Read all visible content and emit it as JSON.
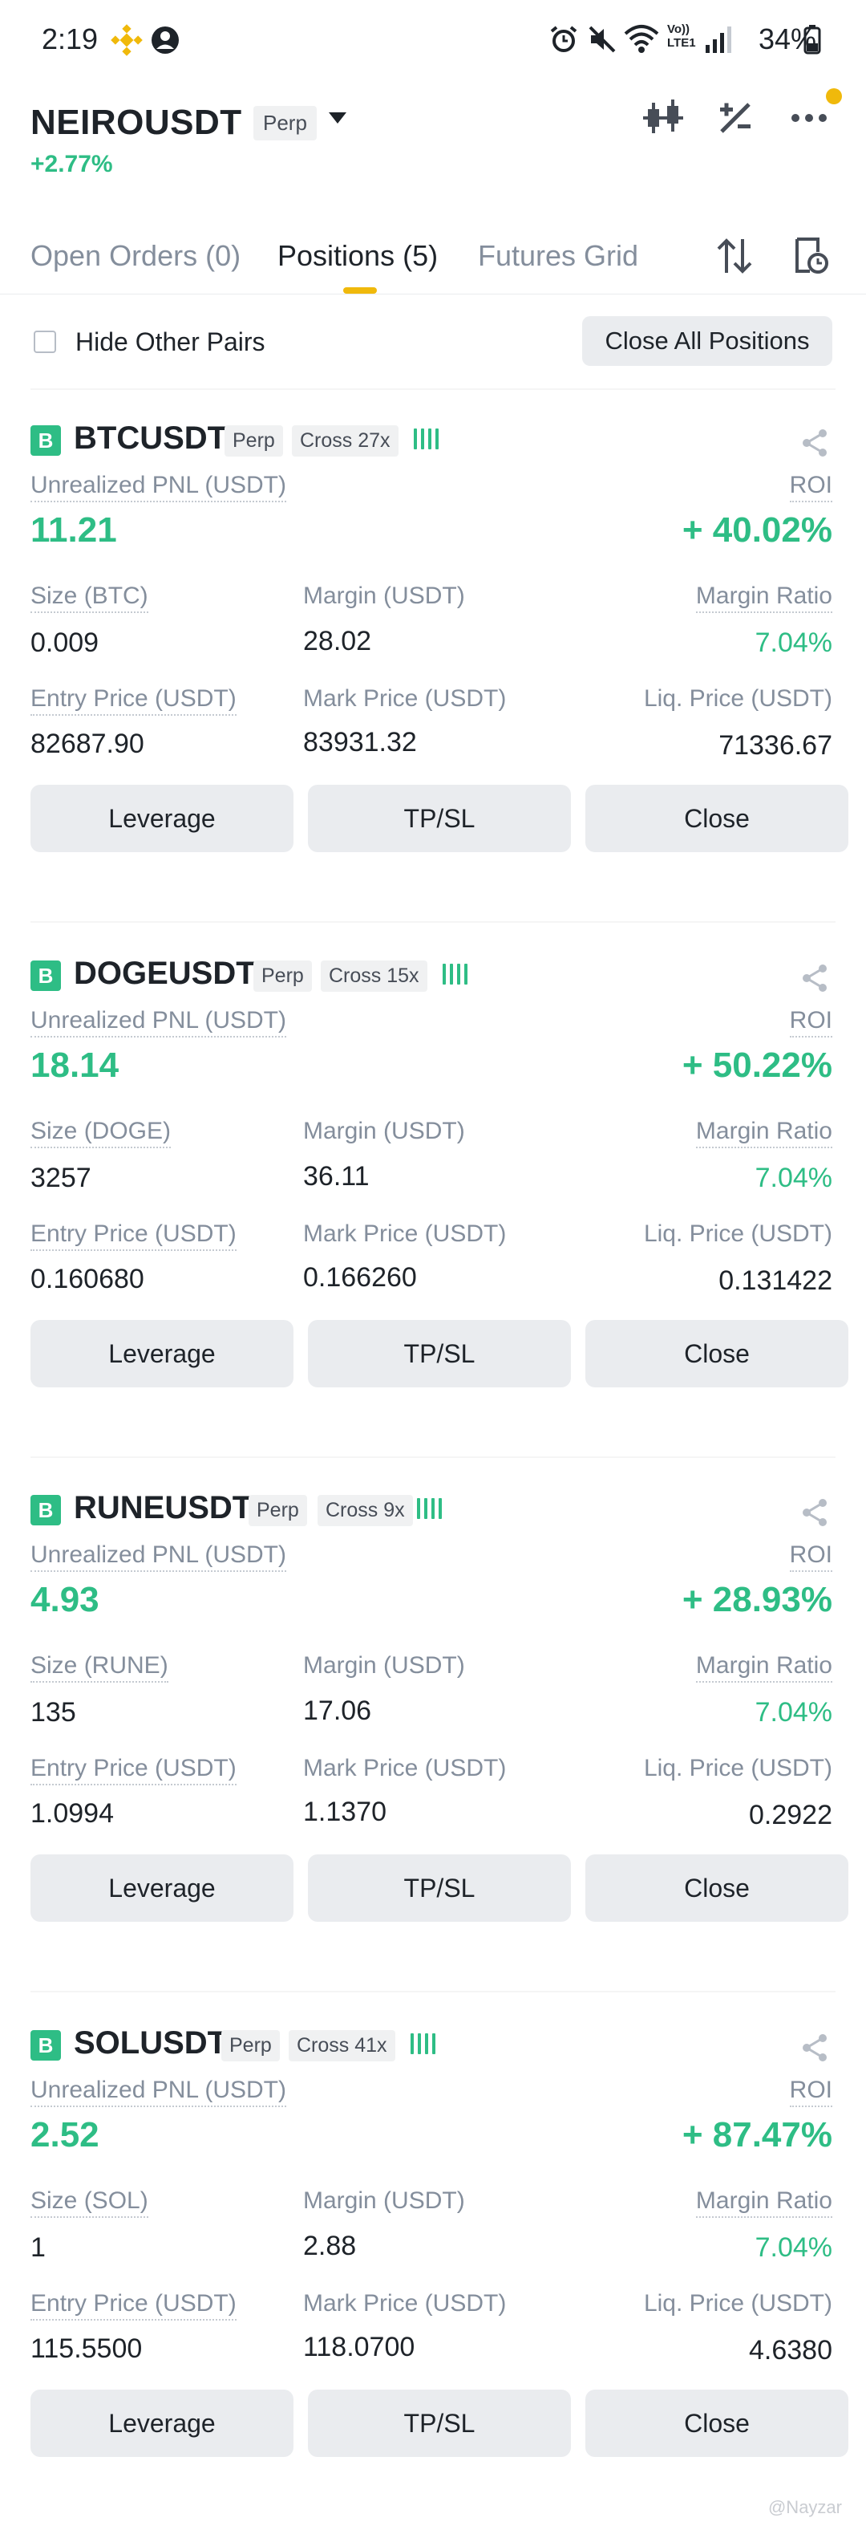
{
  "status_bar": {
    "time": "2:19",
    "battery": "34%",
    "icons": [
      "binance-icon",
      "user-circle-icon",
      "alarm-icon",
      "mute-icon",
      "wifi-icon",
      "volte-icon",
      "signal-icon",
      "battery-icon"
    ],
    "volte_top": "Vo))",
    "volte_bottom": "LTE1"
  },
  "header": {
    "symbol": "NEIROUSDT",
    "badge": "Perp",
    "change": "+2.77%",
    "icons": [
      "candlestick-icon",
      "percent-icon",
      "more-icon"
    ]
  },
  "tabs": [
    {
      "label": "Open Orders (0)",
      "active": false
    },
    {
      "label": "Positions (5)",
      "active": true
    },
    {
      "label": "Futures Grid",
      "active": false
    }
  ],
  "tab_icons": [
    "sort-icon",
    "history-icon"
  ],
  "filter": {
    "hide_other_pairs": "Hide Other Pairs",
    "close_all": "Close All Positions"
  },
  "labels": {
    "unrealized_pnl": "Unrealized PNL (USDT)",
    "roi": "ROI",
    "margin": "Margin (USDT)",
    "margin_ratio": "Margin Ratio",
    "entry_price": "Entry Price (USDT)",
    "mark_price": "Mark Price (USDT)",
    "liq_price": "Liq. Price (USDT)",
    "leverage_btn": "Leverage",
    "tpsl_btn": "TP/SL",
    "close_btn": "Close"
  },
  "positions": [
    {
      "badge": "B",
      "symbol": "BTCUSDT",
      "type": "Perp",
      "mode": "Cross 27x",
      "pnl": "11.21",
      "roi": "+ 40.02%",
      "size_label": "Size (BTC)",
      "size": "0.009",
      "margin": "28.02",
      "margin_ratio": "7.04%",
      "entry_price": "82687.90",
      "mark_price": "83931.32",
      "liq_price": "71336.67"
    },
    {
      "badge": "B",
      "symbol": "DOGEUSDT",
      "type": "Perp",
      "mode": "Cross 15x",
      "pnl": "18.14",
      "roi": "+ 50.22%",
      "size_label": "Size (DOGE)",
      "size": "3257",
      "margin": "36.11",
      "margin_ratio": "7.04%",
      "entry_price": "0.160680",
      "mark_price": "0.166260",
      "liq_price": "0.131422"
    },
    {
      "badge": "B",
      "symbol": "RUNEUSDT",
      "type": "Perp",
      "mode": "Cross 9x",
      "pnl": "4.93",
      "roi": "+ 28.93%",
      "size_label": "Size (RUNE)",
      "size": "135",
      "margin": "17.06",
      "margin_ratio": "7.04%",
      "entry_price": "1.0994",
      "mark_price": "1.1370",
      "liq_price": "0.2922"
    },
    {
      "badge": "B",
      "symbol": "SOLUSDT",
      "type": "Perp",
      "mode": "Cross 41x",
      "pnl": "2.52",
      "roi": "+ 87.47%",
      "size_label": "Size (SOL)",
      "size": "1",
      "margin": "2.88",
      "margin_ratio": "7.04%",
      "entry_price": "115.5500",
      "mark_price": "118.0700",
      "liq_price": "4.6380"
    }
  ],
  "watermark": "@Nayzar",
  "colors": {
    "green": "#2ebd85",
    "yellow": "#f0b90b",
    "text": "#1e2329",
    "muted": "#848e9c"
  }
}
